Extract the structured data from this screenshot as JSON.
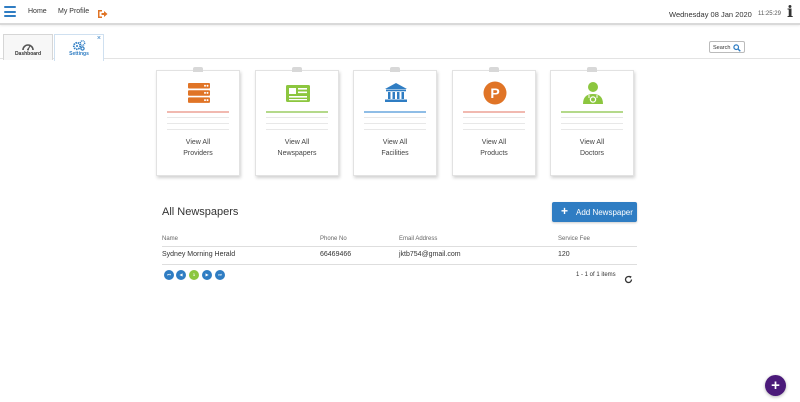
{
  "header": {
    "home_label": "Home",
    "profile_label": "My Profile",
    "date": "Wednesday 08 Jan 2020",
    "time": "11:25:29",
    "info_glyph": "i"
  },
  "tabs": [
    {
      "label": "Dashboard",
      "icon": "gauge-icon"
    },
    {
      "label": "Settings",
      "icon": "gears-icon",
      "close": "×"
    }
  ],
  "search": {
    "label": "Search"
  },
  "cards": [
    {
      "line1": "View All",
      "line2": "Providers",
      "icon": "server-icon",
      "color": "#e07426"
    },
    {
      "line1": "View All",
      "line2": "Newspapers",
      "icon": "newspaper-icon",
      "color": "#8cc63f"
    },
    {
      "line1": "View All",
      "line2": "Facilities",
      "icon": "institution-icon",
      "color": "#2f7dc3"
    },
    {
      "line1": "View All",
      "line2": "Products",
      "icon": "product-p-icon",
      "color": "#e07426",
      "glyph": "P"
    },
    {
      "line1": "View All",
      "line2": "Doctors",
      "icon": "doctor-icon",
      "color": "#8cc63f"
    }
  ],
  "section": {
    "title": "All Newspapers",
    "add_button_plus": "+",
    "add_button_label": "Add Newspaper"
  },
  "table": {
    "columns": [
      "Name",
      "Phone No",
      "Email Address",
      "Service Fee"
    ],
    "rows": [
      [
        "Sydney Morning Herald",
        "66469466",
        "jktb754@gmail.com",
        "120"
      ]
    ]
  },
  "pager": {
    "first": "⏮",
    "prev": "◀",
    "current": "1",
    "next": "▶",
    "last": "⏭",
    "items_text": "1 - 1 of 1 items"
  },
  "fab": {
    "glyph": "+"
  },
  "colors": {
    "primary": "#2f7dc3",
    "orange": "#e07426",
    "green": "#8cc63f",
    "fab": "#4b1a7a"
  }
}
